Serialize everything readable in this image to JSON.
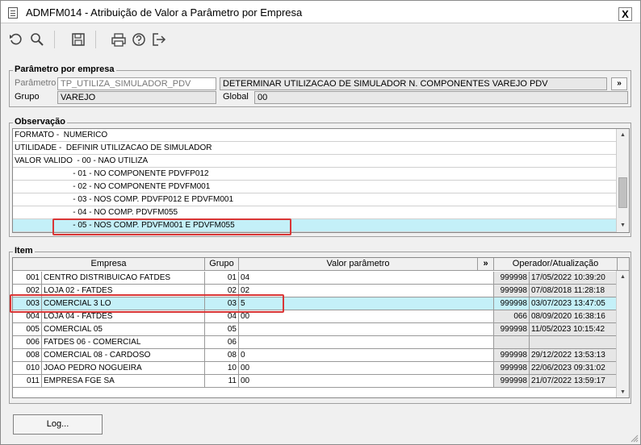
{
  "window": {
    "title": "ADMFM014 - Atribuição de Valor a Parâmetro por Empresa",
    "close_label": "X"
  },
  "toolbar": {
    "icons": [
      "undo-icon",
      "search-icon",
      "save-icon",
      "print-icon",
      "help-icon",
      "exit-icon"
    ]
  },
  "parametro_group": {
    "title": "Parâmetro por empresa",
    "parametro_label": "Parâmetro",
    "parametro_value": "TP_UTILIZA_SIMULADOR_PDV",
    "descricao_value": "DETERMINAR UTILIZACAO DE SIMULADOR N. COMPONENTES VAREJO PDV",
    "expand_label": "»",
    "grupo_label": "Grupo",
    "grupo_value": "VAREJO",
    "global_label": "Global",
    "global_value": "00"
  },
  "observacao": {
    "title": "Observação",
    "lines": [
      "FORMATO -  NUMERICO",
      "UTILIDADE -  DEFINIR UTILIZACAO DE SIMULADOR",
      "VALOR VALIDO  - 00 - NAO UTILIZA",
      "                          - 01 - NO COMPONENTE PDVFP012",
      "                          - 02 - NO COMPONENTE PDVFM001",
      "                          - 03 - NOS COMP. PDVFP012 E PDVFM001",
      "                          - 04 - NO COMP. PDVFM055",
      "                          - 05 - NOS COMP. PDVFM001 E PDVFM055"
    ]
  },
  "item": {
    "title": "Item",
    "columns": {
      "empresa": "Empresa",
      "grupo": "Grupo",
      "valor": "Valor parâmetro",
      "expand": "»",
      "operador": "Operador/Atualização"
    },
    "rows": [
      {
        "cod": "001",
        "nome": "CENTRO DISTRIBUICAO FATDES",
        "grupo": "01",
        "valor": "04",
        "operador": "999998",
        "data": "17/05/2022 10:39:20"
      },
      {
        "cod": "002",
        "nome": "LOJA 02 - FATDES",
        "grupo": "02",
        "valor": "02",
        "operador": "999998",
        "data": "07/08/2018 11:28:18"
      },
      {
        "cod": "003",
        "nome": "COMERCIAL 3 LO",
        "grupo": "03",
        "valor": "5",
        "operador": "999998",
        "data": "03/07/2023 13:47:05"
      },
      {
        "cod": "004",
        "nome": "LOJA 04 - FATDES",
        "grupo": "04",
        "valor": "00",
        "operador": "066",
        "data": "08/09/2020 16:38:16"
      },
      {
        "cod": "005",
        "nome": "COMERCIAL 05",
        "grupo": "05",
        "valor": "",
        "operador": "999998",
        "data": "11/05/2023 10:15:42"
      },
      {
        "cod": "006",
        "nome": "FATDES 06 - COMERCIAL",
        "grupo": "06",
        "valor": "",
        "operador": "",
        "data": ""
      },
      {
        "cod": "008",
        "nome": "COMERCIAL 08 - CARDOSO",
        "grupo": "08",
        "valor": "0",
        "operador": "999998",
        "data": "29/12/2022 13:53:13"
      },
      {
        "cod": "010",
        "nome": "JOAO PEDRO NOGUEIRA",
        "grupo": "10",
        "valor": "00",
        "operador": "999998",
        "data": "22/06/2023 09:31:02"
      },
      {
        "cod": "011",
        "nome": "EMPRESA FGE SA",
        "grupo": "11",
        "valor": "00",
        "operador": "999998",
        "data": "21/07/2022 13:59:17"
      }
    ]
  },
  "footer": {
    "log_label": "Log..."
  }
}
